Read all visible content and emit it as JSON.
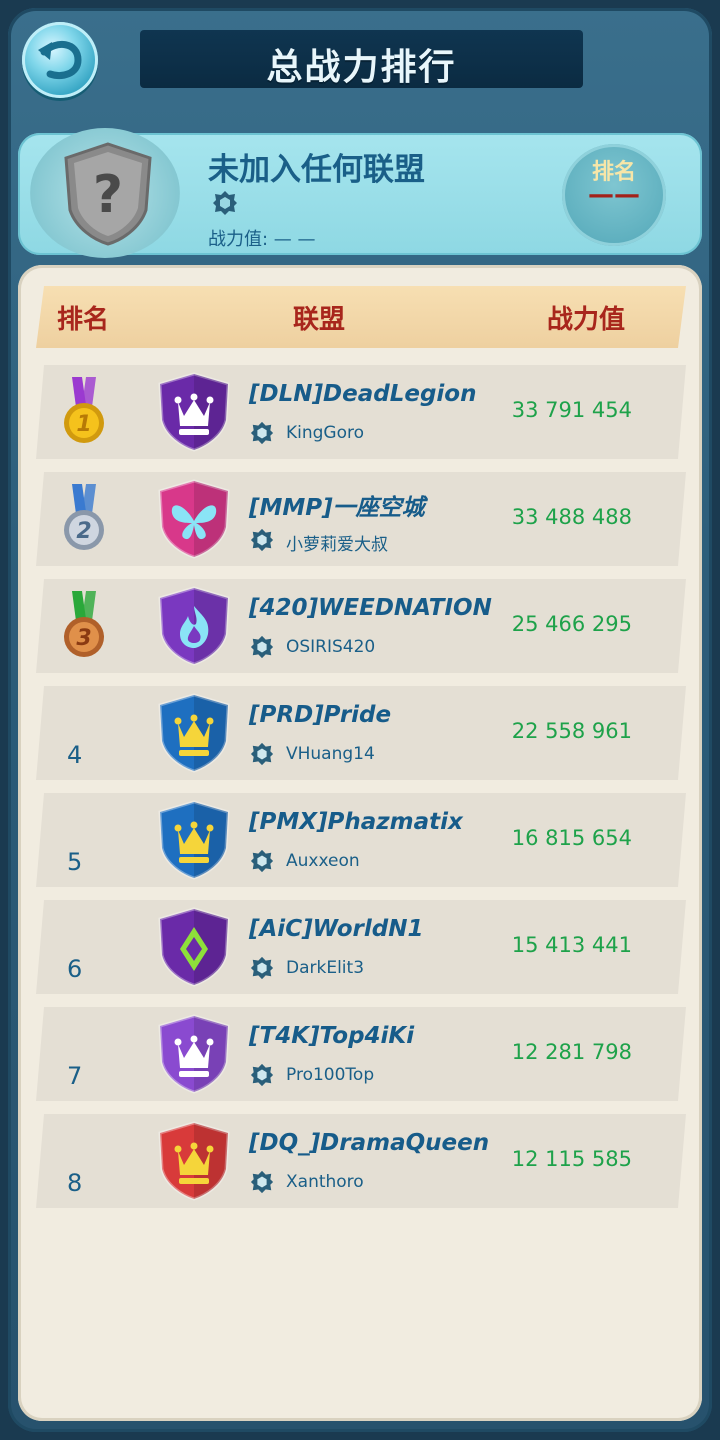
{
  "header": {
    "title": "总战力排行",
    "back_icon": "back-arrow-icon"
  },
  "my_alliance": {
    "name": "未加入任何联盟",
    "power_label": "战力值: — —",
    "rank_label": "排名",
    "rank_value": "——",
    "icon": "question-shield-icon"
  },
  "table": {
    "headers": {
      "rank": "排名",
      "alliance": "联盟",
      "power": "战力值"
    },
    "rows": [
      {
        "rank": "1",
        "medal": "gold",
        "name": "[DLN]DeadLegion",
        "leader": "KingGoro",
        "power": "33 791 454",
        "badge_color": "#6a2aa8",
        "badge_icon": "crown-icon"
      },
      {
        "rank": "2",
        "medal": "silver",
        "name": "[MMP]一座空城",
        "leader": "小萝莉爱大叔",
        "power": "33 488 488",
        "badge_color": "#d8388a",
        "badge_icon": "butterfly-icon"
      },
      {
        "rank": "3",
        "medal": "bronze",
        "name": "[420]WEEDNATION",
        "leader": "OSIRIS420",
        "power": "25 466 295",
        "badge_color": "#7a38c0",
        "badge_icon": "flame-icon"
      },
      {
        "rank": "4",
        "medal": "",
        "name": "[PRD]Pride",
        "leader": "VHuang14",
        "power": "22 558 961",
        "badge_color": "#1e6fc0",
        "badge_icon": "crown-icon"
      },
      {
        "rank": "5",
        "medal": "",
        "name": "[PMX]Phazmatix",
        "leader": "Auxxeon",
        "power": "16 815 654",
        "badge_color": "#1e6fc0",
        "badge_icon": "crown-icon"
      },
      {
        "rank": "6",
        "medal": "",
        "name": "[AiC]WorldN1",
        "leader": "DarkElit3",
        "power": "15 413 441",
        "badge_color": "#6a2aa8",
        "badge_icon": "diamond-icon"
      },
      {
        "rank": "7",
        "medal": "",
        "name": "[T4K]Top4iKi",
        "leader": "Pro100Top",
        "power": "12 281 798",
        "badge_color": "#8a4ad0",
        "badge_icon": "crown-icon"
      },
      {
        "rank": "8",
        "medal": "",
        "name": "[DQ_]DramaQueen",
        "leader": "Xanthoro",
        "power": "12 115 585",
        "badge_color": "#d83a3a",
        "badge_icon": "crown-icon"
      }
    ]
  }
}
